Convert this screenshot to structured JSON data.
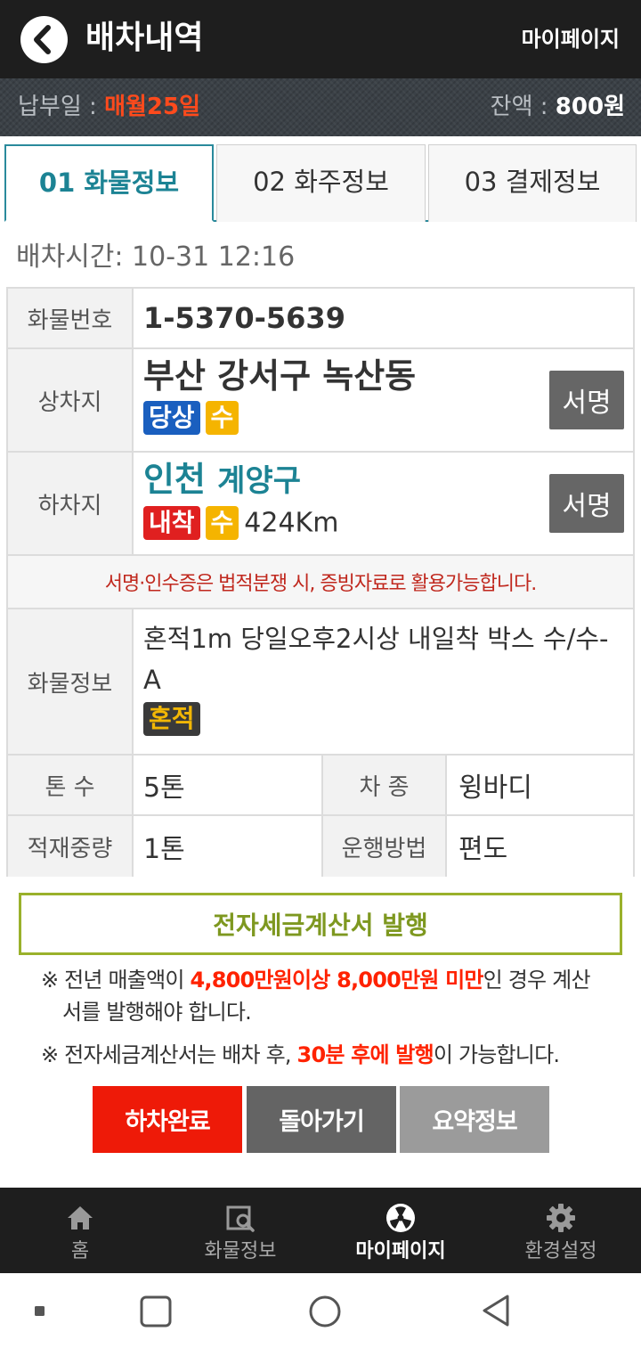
{
  "header": {
    "title": "배차내역",
    "mypage_link": "마이페이지"
  },
  "infobar": {
    "pay_label": "납부일 : ",
    "pay_value": "매월25일",
    "balance_label": "잔액 : ",
    "balance_value": "800원"
  },
  "tabs": [
    {
      "label": "01 화물정보",
      "active": true
    },
    {
      "label": "02 화주정보",
      "active": false
    },
    {
      "label": "03 결제정보",
      "active": false
    }
  ],
  "dispatch_time": "배차시간: 10-31 12:16",
  "table": {
    "cargo_no_label": "화물번호",
    "cargo_no": "1-5370-5639",
    "load_label": "상차지",
    "load_place": "부산 강서구 녹산동",
    "load_badges": [
      "당상",
      "수"
    ],
    "unload_label": "하차지",
    "unload_city": "인천",
    "unload_district": "계양구",
    "unload_badges": [
      "내착",
      "수"
    ],
    "distance": "424Km",
    "sign_label": "서명",
    "notice": "서명·인수증은 법적분쟁 시, 증빙자료로 활용가능합니다.",
    "cargo_info_label": "화물정보",
    "cargo_info": "혼적1m 당일오후2시상 내일착 박스 수/수-A",
    "cargo_badge": "혼적",
    "ton_label": "톤 수",
    "ton_value": "5톤",
    "vehicle_label": "차 종",
    "vehicle_value": "윙바디",
    "weight_label": "적재중량",
    "weight_value": "1톤",
    "method_label": "운행방법",
    "method_value": "편도"
  },
  "tax": {
    "button": "전자세금계산서 발행",
    "note1_pre": "※ 전년 매출액이 ",
    "note1_red": "4,800만원이상 8,000만원 미만",
    "note1_post": "인 경우 계산",
    "note1_line2": "서를 발행해야 합니다.",
    "note2_pre": "※ 전자세금계산서는 배차 후, ",
    "note2_red": "30분 후에 발행",
    "note2_post": "이 가능합니다."
  },
  "actions": {
    "complete": "하차완료",
    "back": "돌아가기",
    "summary": "요약정보"
  },
  "colors": {
    "complete": "#ee1a08",
    "back": "#646464",
    "summary": "#9b9b9b",
    "accent": "#1c8394"
  },
  "bottom_nav": [
    {
      "label": "홈",
      "icon": "home-icon"
    },
    {
      "label": "화물정보",
      "icon": "cargo-search-icon"
    },
    {
      "label": "마이페이지",
      "icon": "mypage-icon",
      "active": true
    },
    {
      "label": "환경설정",
      "icon": "gear-icon"
    }
  ]
}
